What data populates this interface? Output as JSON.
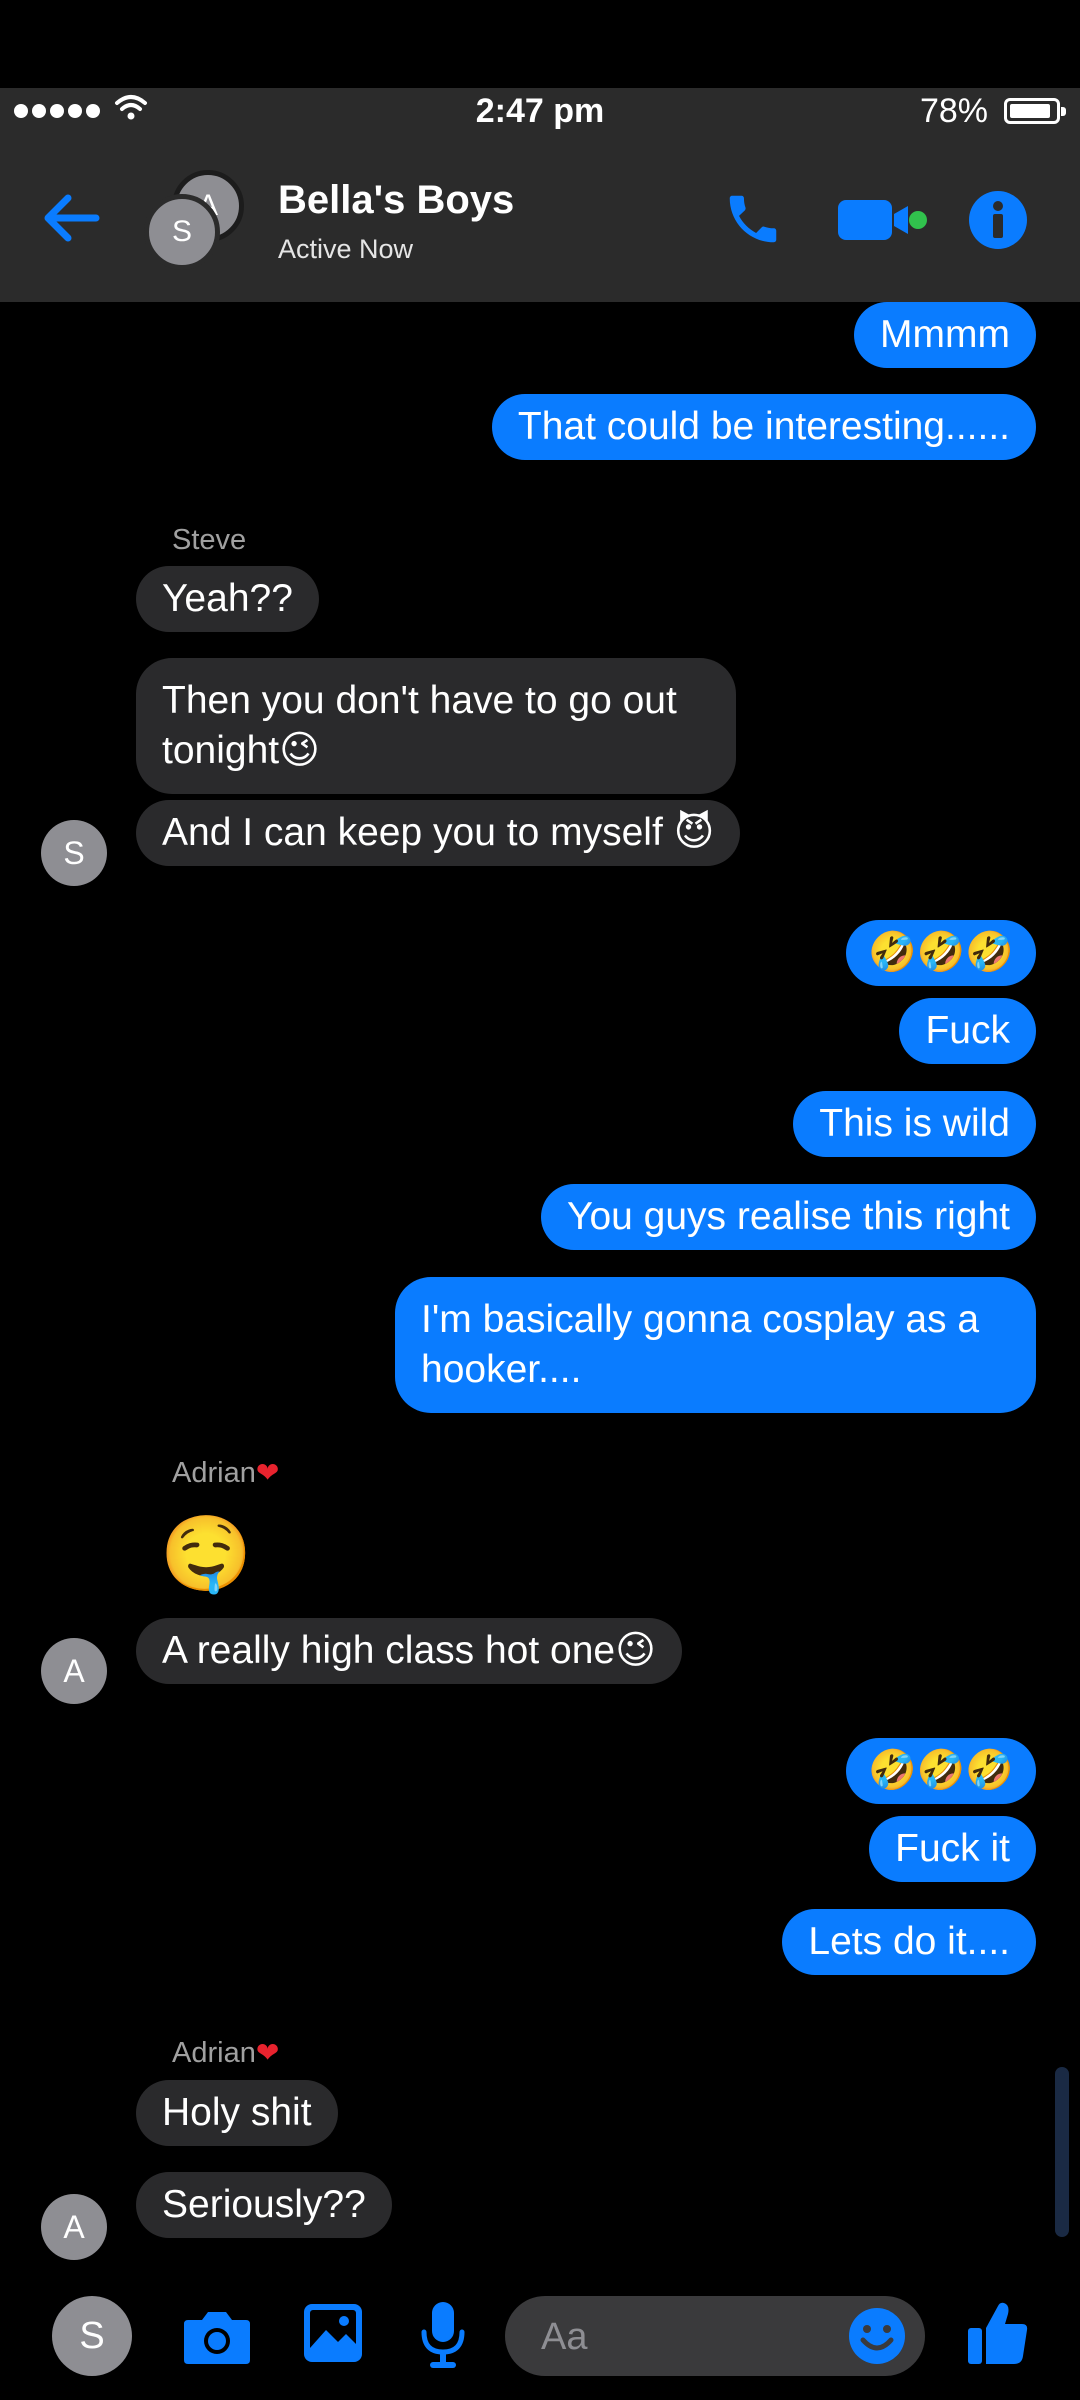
{
  "status": {
    "time": "2:47 pm",
    "battery": "78%",
    "battery_level": 0.78
  },
  "header": {
    "title": "Bella's Boys",
    "subtitle": "Active Now",
    "avatar_back_initial": "A",
    "avatar_front_initial": "S"
  },
  "messages": {
    "m1": "Mmmm",
    "m2": "That could be interesting......",
    "steve_name": "Steve",
    "m3": "Yeah??",
    "m4": "Then you don't have to go out tonight😉",
    "m5": "And I can keep you to myself 😈",
    "steve_avatar": "S",
    "m6": "🤣🤣🤣",
    "m7": "Fuck",
    "m8": "This is wild",
    "m9": "You guys realise this right",
    "m10": "I'm basically gonna cosplay as a hooker....",
    "adrian_name": "Adrian",
    "adrian_heart": "❤",
    "m11": "🤤",
    "m12": "A really high class hot one😉",
    "adrian_avatar": "A",
    "m13": "🤣🤣🤣",
    "m14": "Fuck it",
    "m15": "Lets do it....",
    "adrian_name_2": "Adrian",
    "adrian_heart_2": "❤",
    "m16": "Holy shit",
    "m17": "Seriously??",
    "adrian_avatar_2": "A"
  },
  "composer": {
    "my_initial": "S",
    "placeholder": "Aa"
  },
  "colors": {
    "accent": "#0a7cff",
    "incoming": "#2a2a2c",
    "online": "#31c24d"
  },
  "icons": [
    "back-arrow-icon",
    "phone-icon",
    "video-icon",
    "info-icon",
    "camera-icon",
    "gallery-icon",
    "microphone-icon",
    "smiley-icon",
    "thumbs-up-icon"
  ]
}
